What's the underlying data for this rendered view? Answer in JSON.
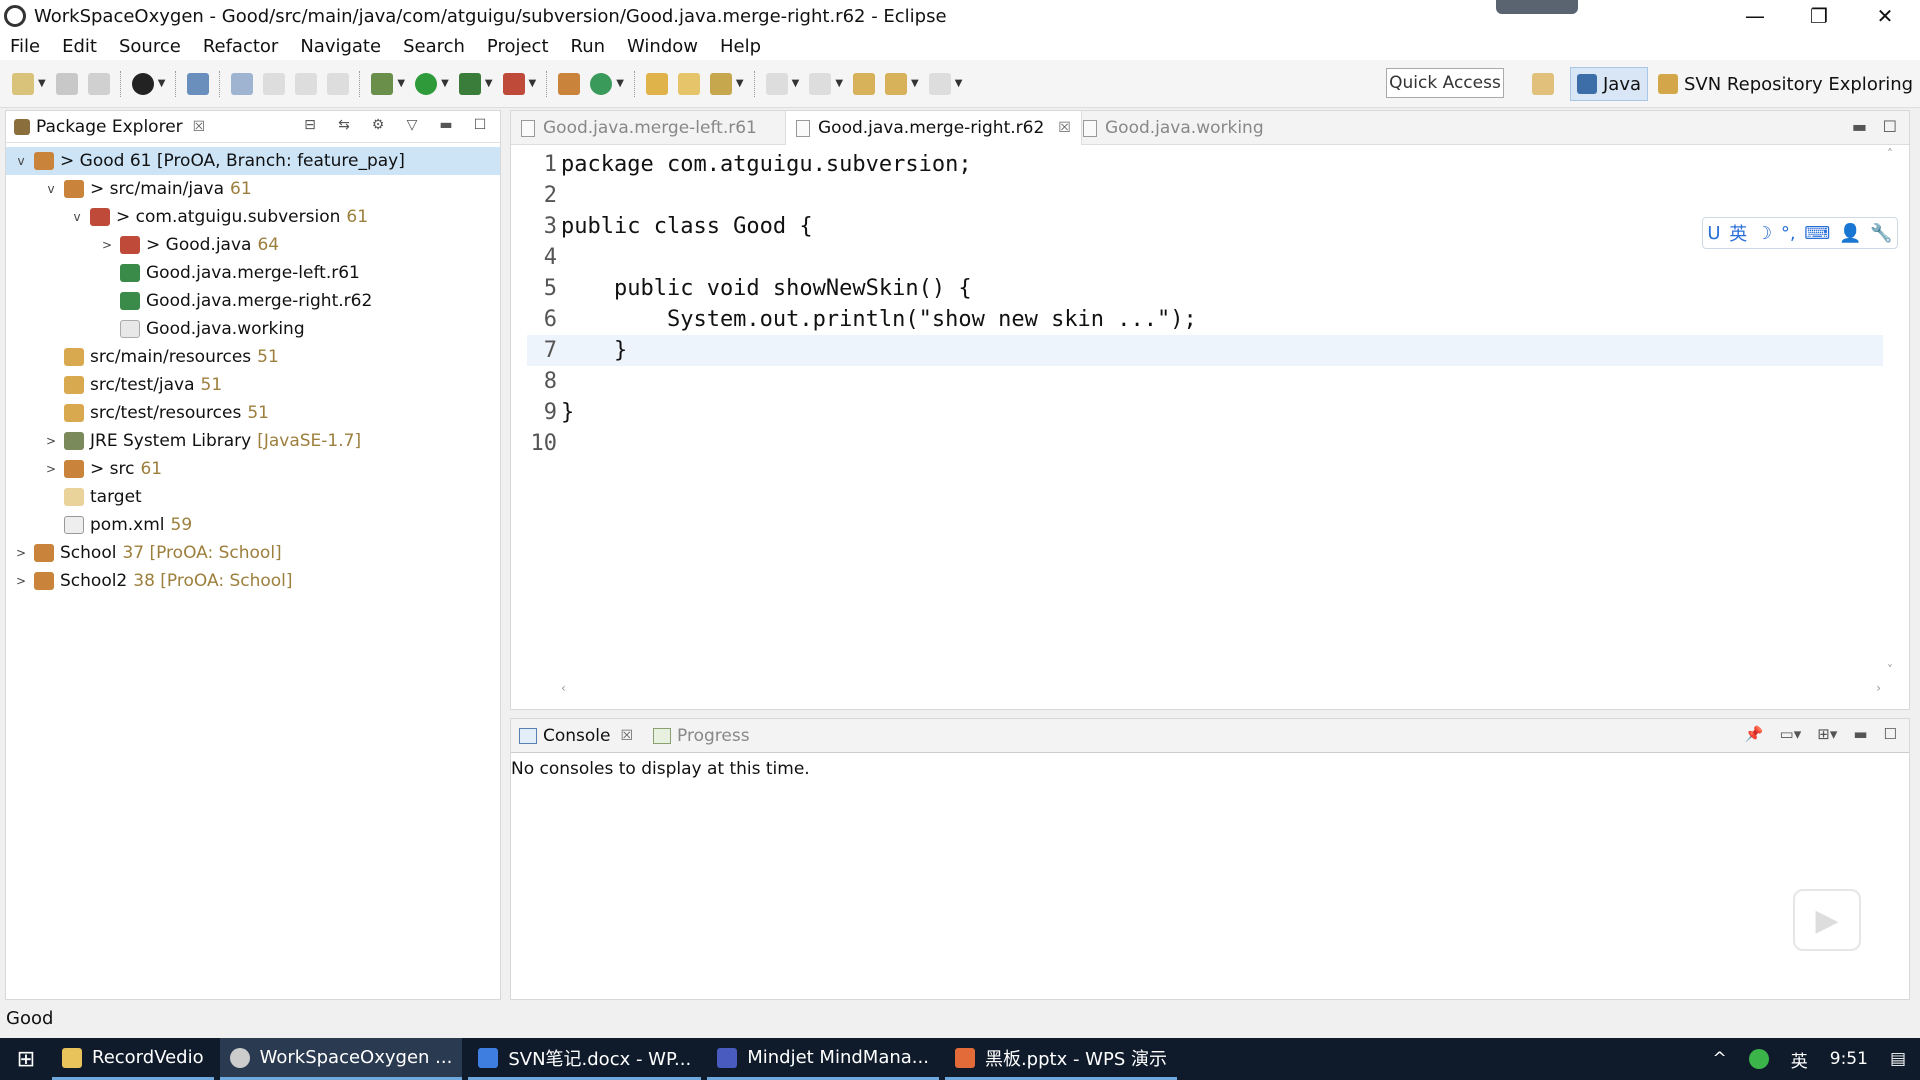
{
  "window": {
    "title": "WorkSpaceOxygen - Good/src/main/java/com/atguigu/subversion/Good.java.merge-right.r62 - Eclipse",
    "minimize": "—",
    "restore": "❐",
    "close": "✕"
  },
  "menu": [
    "File",
    "Edit",
    "Source",
    "Refactor",
    "Navigate",
    "Search",
    "Project",
    "Run",
    "Window",
    "Help"
  ],
  "toolbar": {
    "quick_access": "Quick Access",
    "perspectives": [
      "Java",
      "SVN Repository Exploring"
    ]
  },
  "package_explorer": {
    "title": "Package Explorer",
    "close": "☒",
    "tree": [
      {
        "twisty": "v",
        "label": "> Good 61 [ProOA, Branch: feature_pay]",
        "dim": ""
      },
      {
        "twisty": "v",
        "label": "> src/main/java",
        "dim": "61"
      },
      {
        "twisty": "v",
        "label": "> com.atguigu.subversion",
        "dim": "61"
      },
      {
        "twisty": ">",
        "label": "> Good.java",
        "dim": "64"
      },
      {
        "twisty": "",
        "label": "Good.java.merge-left.r61",
        "dim": ""
      },
      {
        "twisty": "",
        "label": "Good.java.merge-right.r62",
        "dim": ""
      },
      {
        "twisty": "",
        "label": "Good.java.working",
        "dim": ""
      },
      {
        "twisty": "",
        "label": "src/main/resources",
        "dim": "51"
      },
      {
        "twisty": "",
        "label": "src/test/java",
        "dim": "51"
      },
      {
        "twisty": "",
        "label": "src/test/resources",
        "dim": "51"
      },
      {
        "twisty": ">",
        "label": "JRE System Library",
        "dim": "[JavaSE-1.7]"
      },
      {
        "twisty": ">",
        "label": "> src",
        "dim": "61"
      },
      {
        "twisty": "",
        "label": "target",
        "dim": ""
      },
      {
        "twisty": "",
        "label": "pom.xml",
        "dim": "59"
      },
      {
        "twisty": ">",
        "label": "School",
        "dim": "37 [ProOA: School]"
      },
      {
        "twisty": ">",
        "label": "School2",
        "dim": "38 [ProOA: School]"
      }
    ]
  },
  "editor": {
    "tabs": [
      "Good.java.merge-left.r61",
      "Good.java.merge-right.r62",
      "Good.java.working"
    ],
    "close": "☒",
    "lines": [
      {
        "n": "1",
        "text": "package com.atguigu.subversion;"
      },
      {
        "n": "2",
        "text": ""
      },
      {
        "n": "3",
        "text": "public class Good {"
      },
      {
        "n": "4",
        "text": ""
      },
      {
        "n": "5",
        "text": "    public void showNewSkin() {"
      },
      {
        "n": "6",
        "text": "        System.out.println(\"show new skin ...\");"
      },
      {
        "n": "7",
        "text": "    }"
      },
      {
        "n": "8",
        "text": ""
      },
      {
        "n": "9",
        "text": "}"
      },
      {
        "n": "10",
        "text": ""
      }
    ],
    "ime": [
      "U",
      "英",
      "☽",
      "°,",
      "⌨",
      "👤",
      "🔧"
    ]
  },
  "console": {
    "tabs": [
      "Console",
      "Progress"
    ],
    "close": "☒",
    "message": "No consoles to display at this time."
  },
  "status": {
    "text": "Good"
  },
  "taskbar": {
    "start": "⊞",
    "apps": [
      "RecordVedio",
      "WorkSpaceOxygen ...",
      "SVN笔记.docx - WP...",
      "Mindjet MindMana...",
      "黑板.pptx - WPS 演示"
    ],
    "tray": [
      "^",
      "英",
      "9:51"
    ]
  },
  "colors": {
    "selection": "#cde4f7",
    "current_line": "#eef4fb",
    "taskbar": "#0f1b2b",
    "svn_dim": "#9c7f3c"
  }
}
